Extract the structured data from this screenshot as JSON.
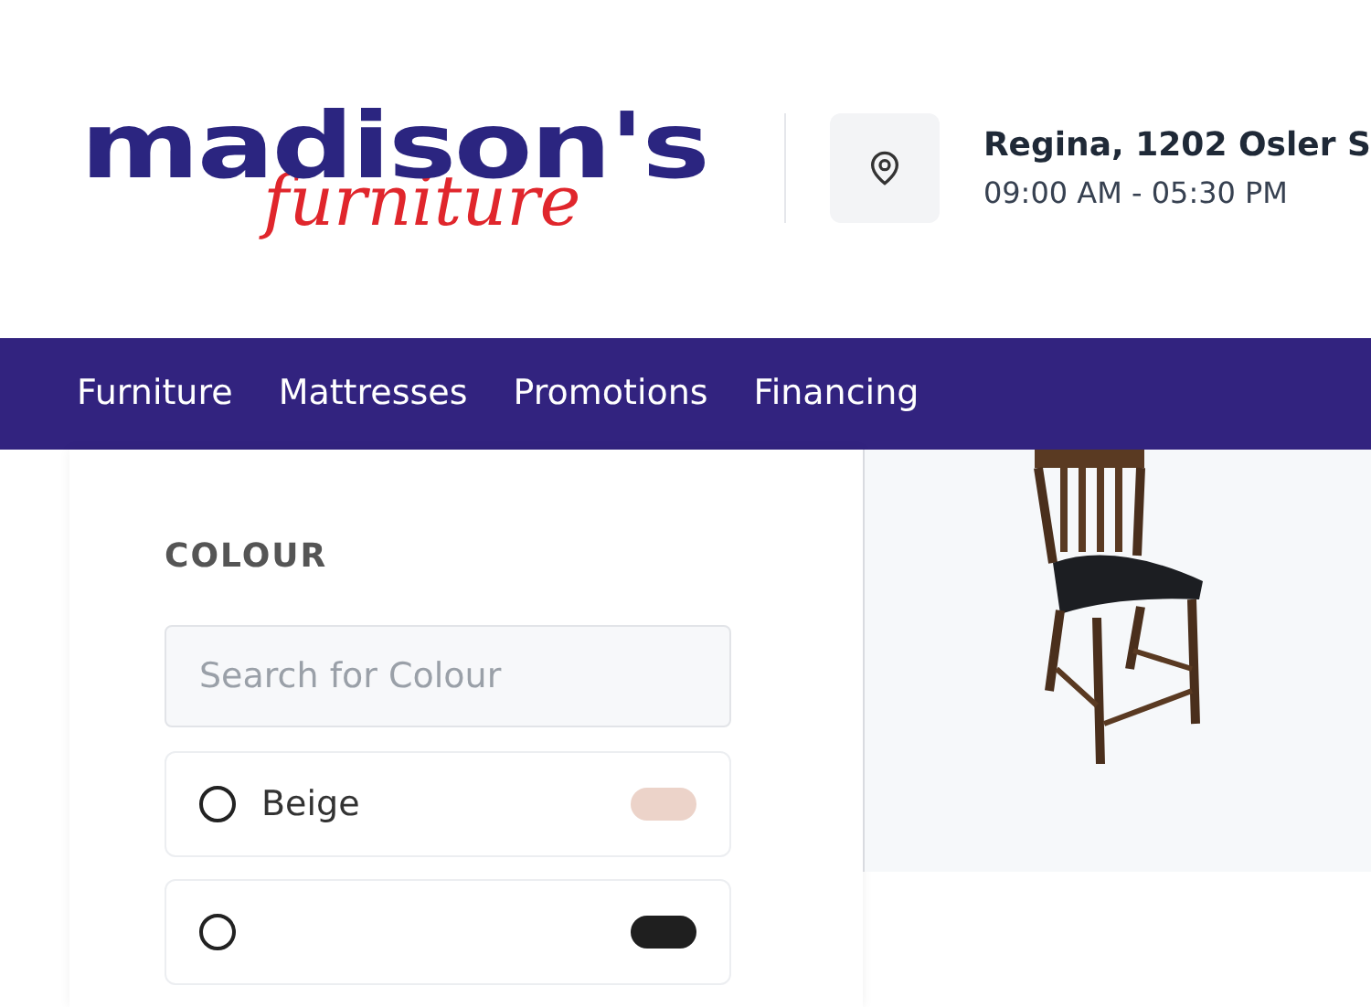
{
  "logo": {
    "wordmark": "madison's",
    "script": "furniture"
  },
  "store": {
    "location": "Regina, 1202 Osler S",
    "hours": "09:00 AM - 05:30 PM"
  },
  "nav": [
    "Furniture",
    "Mattresses",
    "Promotions",
    "Financing"
  ],
  "filter": {
    "title": "COLOUR",
    "search": {
      "placeholder": "Search for Colour"
    },
    "options": [
      {
        "label": "Beige",
        "selected": false,
        "color": "#ecd3c9"
      },
      {
        "selected": false,
        "color": "#1f1f1f"
      }
    ]
  }
}
